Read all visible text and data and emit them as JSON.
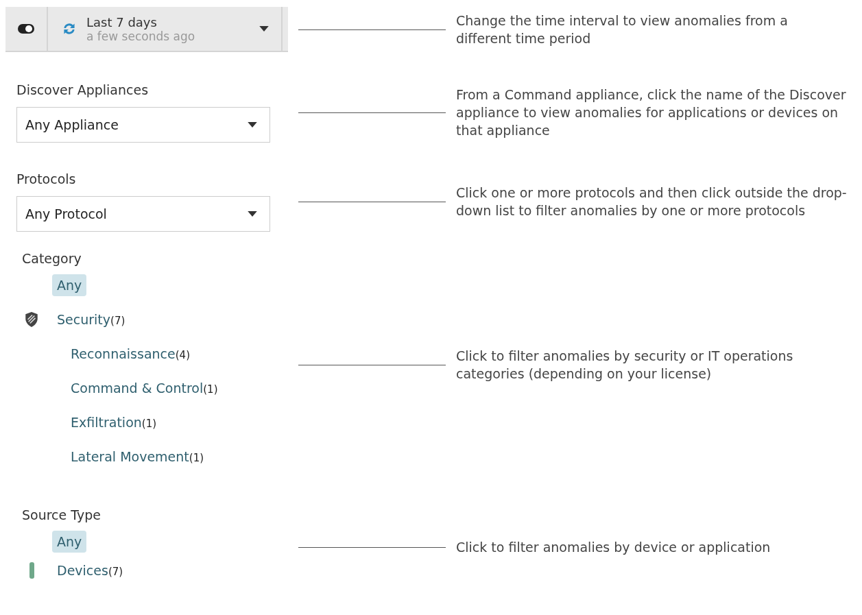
{
  "time_selector": {
    "toggle_on": true,
    "label": "Last 7 days",
    "updated": "a few seconds ago",
    "note": "Change the time interval to view anomalies from a different time period"
  },
  "appliances": {
    "label": "Discover Appliances",
    "value": "Any Appliance",
    "note": "From a Command appliance, click the name of the Discover appliance to view anomalies for applications or devices on that appliance"
  },
  "protocols": {
    "label": "Protocols",
    "value": "Any Protocol",
    "note": "Click one or more protocols and then click outside the drop-down list to filter anomalies by one or more protocols"
  },
  "category": {
    "label": "Category",
    "note": "Click to filter anomalies by security or IT operations categories (depending on your license)",
    "items": [
      {
        "label": "Any",
        "selected": true
      },
      {
        "label": "Security",
        "count": "(7)",
        "kind": "shield",
        "selected": false,
        "children": [
          {
            "label": "Reconnaissance",
            "count": "(4)",
            "selected": false
          },
          {
            "label": "Command & Control",
            "count": "(1)",
            "selected": false
          },
          {
            "label": "Exfiltration",
            "count": "(1)",
            "selected": false
          },
          {
            "label": "Lateral Movement",
            "count": "(1)",
            "selected": false
          }
        ]
      }
    ]
  },
  "source_type": {
    "label": "Source Type",
    "note": "Click to filter anomalies by device or application",
    "items": [
      {
        "label": "Any",
        "selected": true
      },
      {
        "label": "Devices",
        "count": "(7)",
        "kind": "bar",
        "selected": false
      }
    ]
  }
}
